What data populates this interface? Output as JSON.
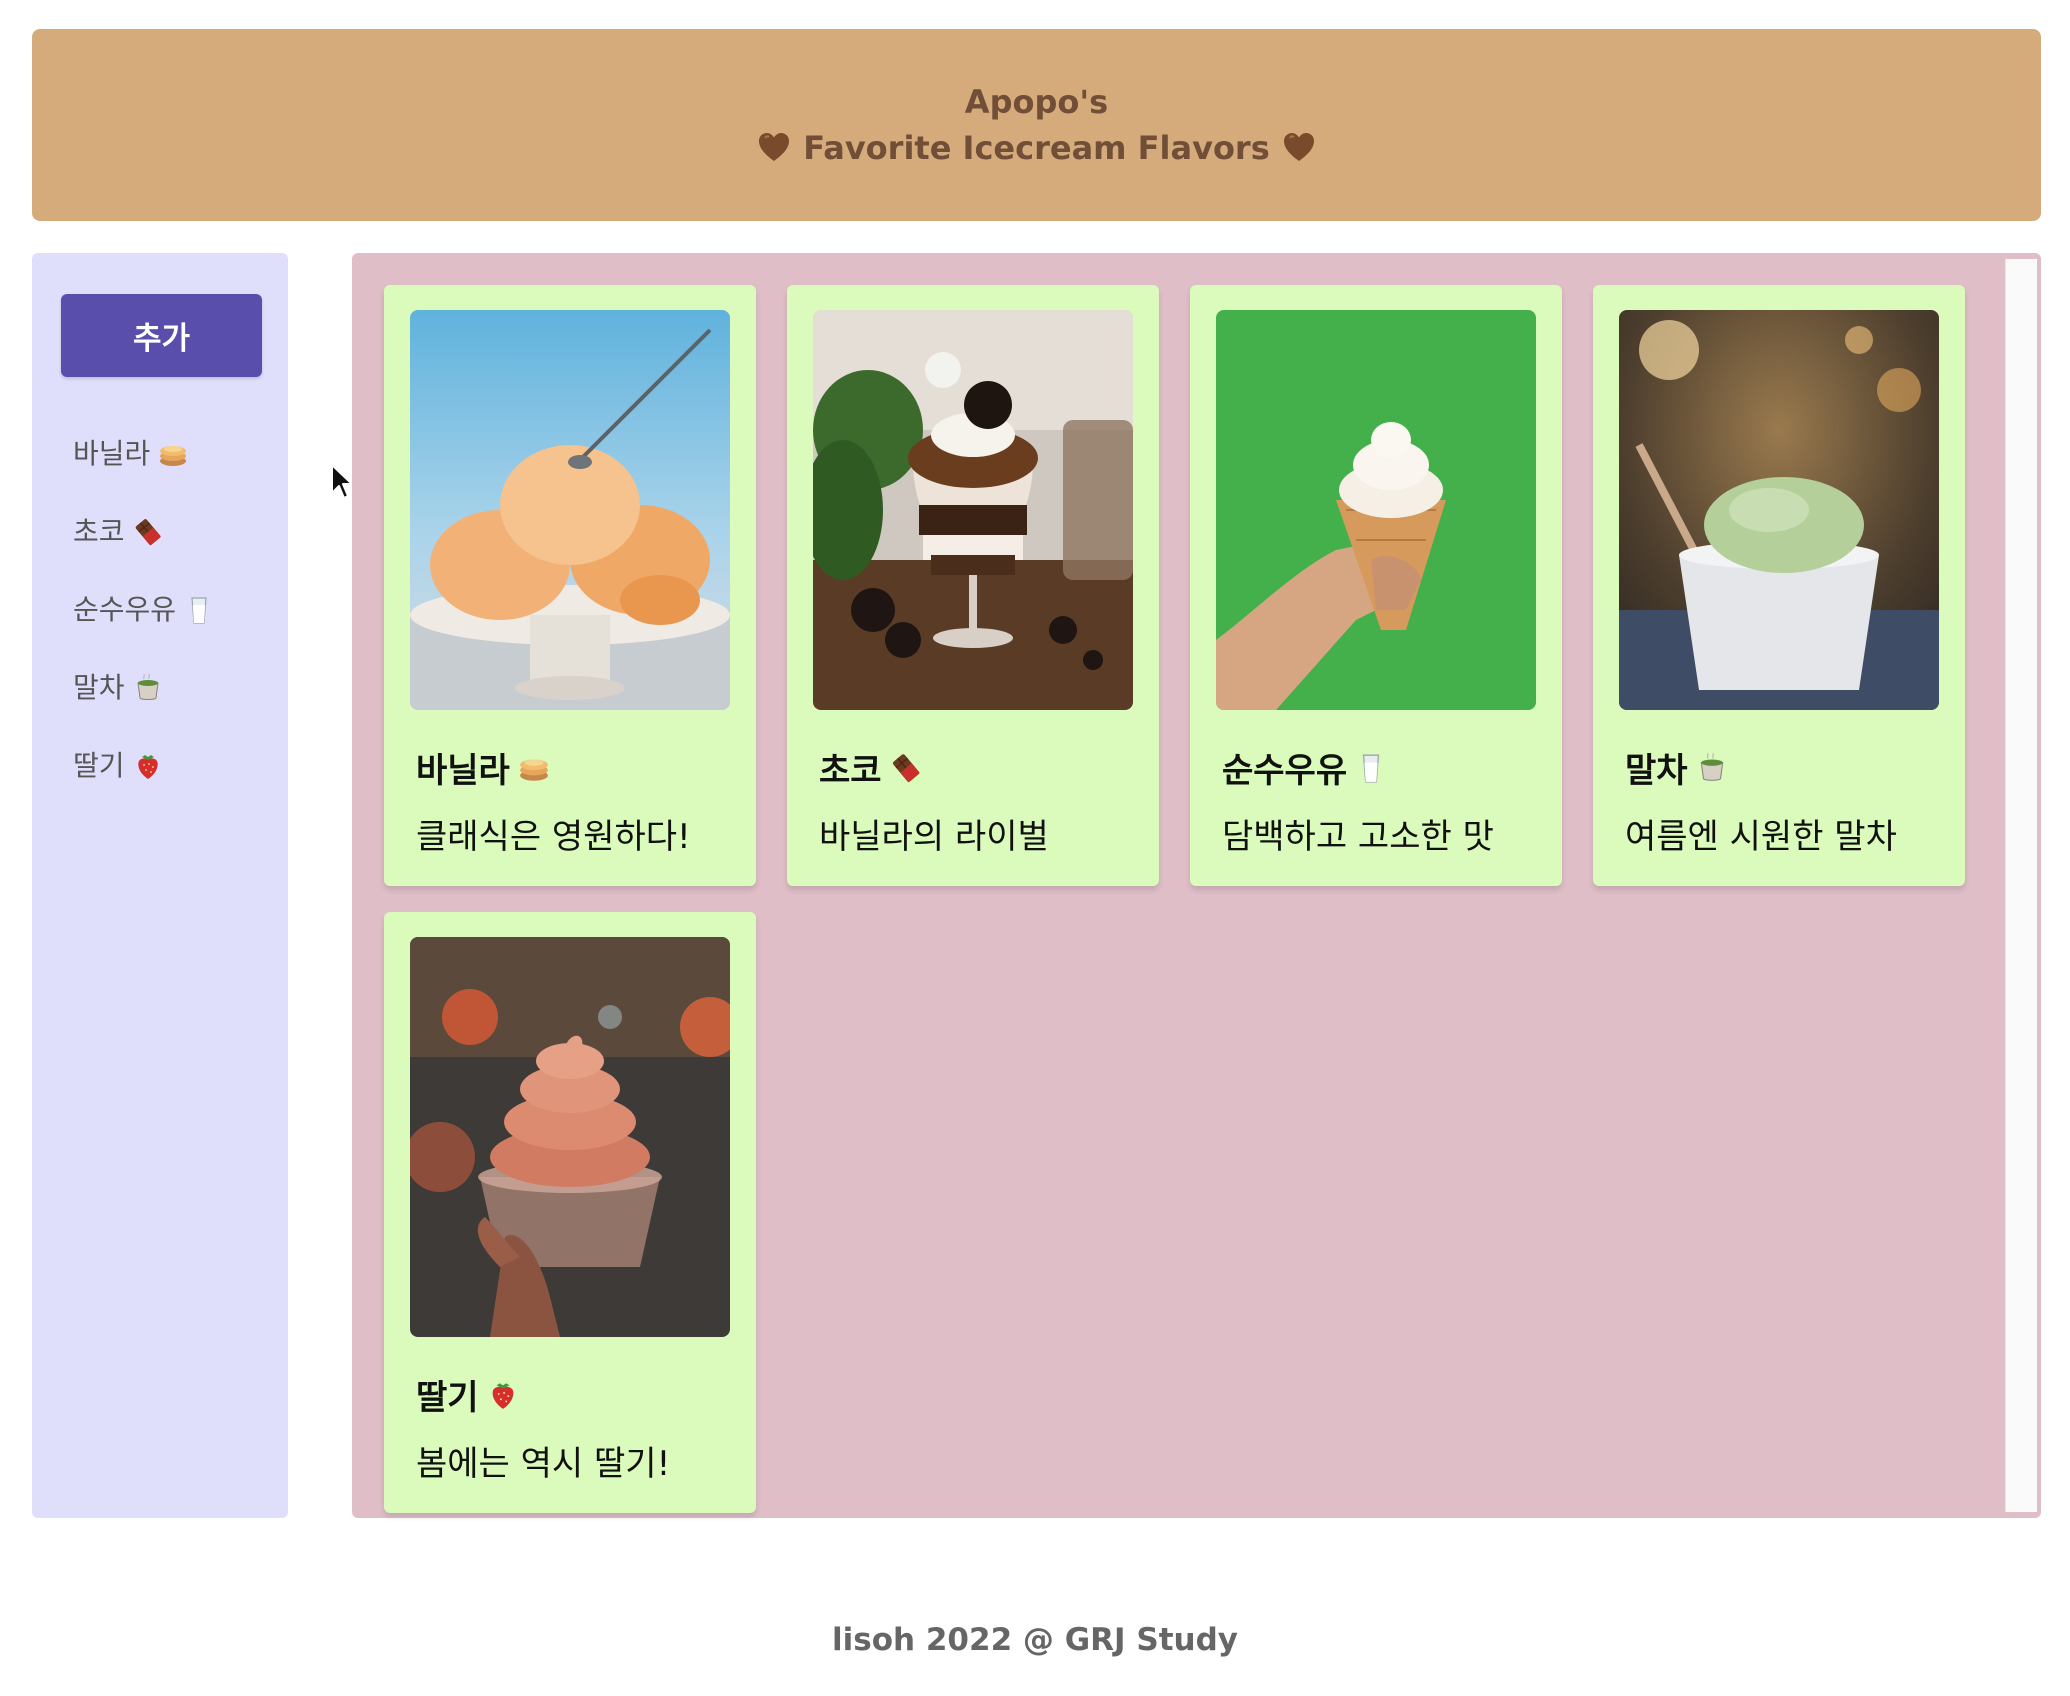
{
  "header": {
    "line1": "Apopo's",
    "line2": "Favorite Icecream Flavors",
    "heart_icon": "brown-heart-icon",
    "color": "#704e37",
    "background": "#d6ab7c"
  },
  "sidebar": {
    "add_label": "추가",
    "items": [
      {
        "label": "바닐라",
        "icon": "pancakes-icon"
      },
      {
        "label": "초코",
        "icon": "chocolate-bar-icon"
      },
      {
        "label": "순수우유",
        "icon": "glass-of-milk-icon"
      },
      {
        "label": "말차",
        "icon": "green-tea-icon"
      },
      {
        "label": "딸기",
        "icon": "strawberry-icon"
      }
    ]
  },
  "cards": [
    {
      "name": "바닐라",
      "icon": "pancakes-icon",
      "desc": "클래식은 영원하다!"
    },
    {
      "name": "초코",
      "icon": "chocolate-bar-icon",
      "desc": "바닐라의 라이벌"
    },
    {
      "name": "순수우유",
      "icon": "glass-of-milk-icon",
      "desc": "담백하고 고소한 맛"
    },
    {
      "name": "말차",
      "icon": "green-tea-icon",
      "desc": "여름엔 시원한 말차"
    },
    {
      "name": "딸기",
      "icon": "strawberry-icon",
      "desc": "봄에는 역시 딸기!"
    }
  ],
  "footer": {
    "text": "lisoh 2022 @ GRJ Study"
  },
  "colors": {
    "sidebar_bg": "#e0dffb",
    "main_bg": "#dfbec7",
    "card_bg": "#dafbbb",
    "button_bg": "#5a4eac"
  }
}
